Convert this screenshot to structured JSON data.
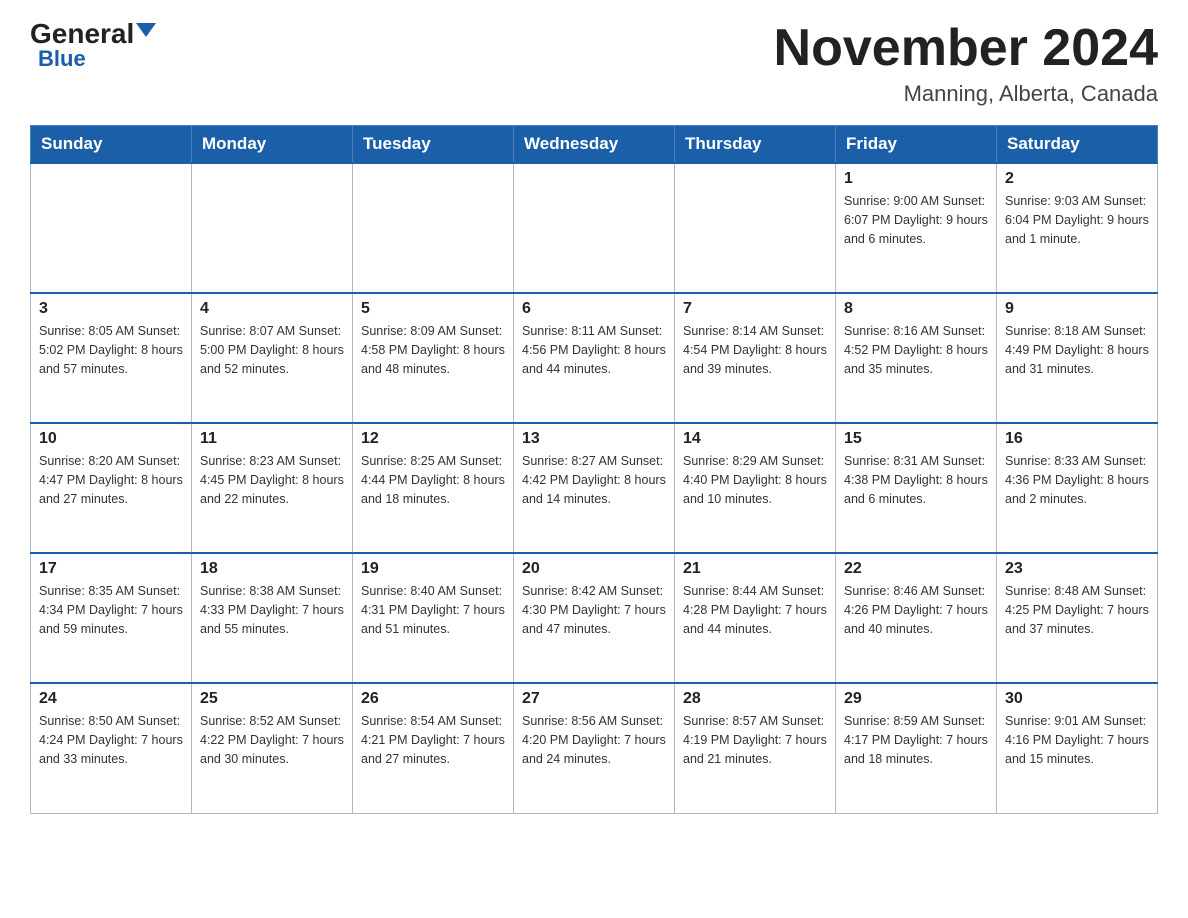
{
  "header": {
    "logo_general": "General",
    "logo_blue": "Blue",
    "month": "November 2024",
    "location": "Manning, Alberta, Canada"
  },
  "days_of_week": [
    "Sunday",
    "Monday",
    "Tuesday",
    "Wednesday",
    "Thursday",
    "Friday",
    "Saturday"
  ],
  "weeks": [
    [
      {
        "day": "",
        "info": ""
      },
      {
        "day": "",
        "info": ""
      },
      {
        "day": "",
        "info": ""
      },
      {
        "day": "",
        "info": ""
      },
      {
        "day": "",
        "info": ""
      },
      {
        "day": "1",
        "info": "Sunrise: 9:00 AM\nSunset: 6:07 PM\nDaylight: 9 hours\nand 6 minutes."
      },
      {
        "day": "2",
        "info": "Sunrise: 9:03 AM\nSunset: 6:04 PM\nDaylight: 9 hours\nand 1 minute."
      }
    ],
    [
      {
        "day": "3",
        "info": "Sunrise: 8:05 AM\nSunset: 5:02 PM\nDaylight: 8 hours\nand 57 minutes."
      },
      {
        "day": "4",
        "info": "Sunrise: 8:07 AM\nSunset: 5:00 PM\nDaylight: 8 hours\nand 52 minutes."
      },
      {
        "day": "5",
        "info": "Sunrise: 8:09 AM\nSunset: 4:58 PM\nDaylight: 8 hours\nand 48 minutes."
      },
      {
        "day": "6",
        "info": "Sunrise: 8:11 AM\nSunset: 4:56 PM\nDaylight: 8 hours\nand 44 minutes."
      },
      {
        "day": "7",
        "info": "Sunrise: 8:14 AM\nSunset: 4:54 PM\nDaylight: 8 hours\nand 39 minutes."
      },
      {
        "day": "8",
        "info": "Sunrise: 8:16 AM\nSunset: 4:52 PM\nDaylight: 8 hours\nand 35 minutes."
      },
      {
        "day": "9",
        "info": "Sunrise: 8:18 AM\nSunset: 4:49 PM\nDaylight: 8 hours\nand 31 minutes."
      }
    ],
    [
      {
        "day": "10",
        "info": "Sunrise: 8:20 AM\nSunset: 4:47 PM\nDaylight: 8 hours\nand 27 minutes."
      },
      {
        "day": "11",
        "info": "Sunrise: 8:23 AM\nSunset: 4:45 PM\nDaylight: 8 hours\nand 22 minutes."
      },
      {
        "day": "12",
        "info": "Sunrise: 8:25 AM\nSunset: 4:44 PM\nDaylight: 8 hours\nand 18 minutes."
      },
      {
        "day": "13",
        "info": "Sunrise: 8:27 AM\nSunset: 4:42 PM\nDaylight: 8 hours\nand 14 minutes."
      },
      {
        "day": "14",
        "info": "Sunrise: 8:29 AM\nSunset: 4:40 PM\nDaylight: 8 hours\nand 10 minutes."
      },
      {
        "day": "15",
        "info": "Sunrise: 8:31 AM\nSunset: 4:38 PM\nDaylight: 8 hours\nand 6 minutes."
      },
      {
        "day": "16",
        "info": "Sunrise: 8:33 AM\nSunset: 4:36 PM\nDaylight: 8 hours\nand 2 minutes."
      }
    ],
    [
      {
        "day": "17",
        "info": "Sunrise: 8:35 AM\nSunset: 4:34 PM\nDaylight: 7 hours\nand 59 minutes."
      },
      {
        "day": "18",
        "info": "Sunrise: 8:38 AM\nSunset: 4:33 PM\nDaylight: 7 hours\nand 55 minutes."
      },
      {
        "day": "19",
        "info": "Sunrise: 8:40 AM\nSunset: 4:31 PM\nDaylight: 7 hours\nand 51 minutes."
      },
      {
        "day": "20",
        "info": "Sunrise: 8:42 AM\nSunset: 4:30 PM\nDaylight: 7 hours\nand 47 minutes."
      },
      {
        "day": "21",
        "info": "Sunrise: 8:44 AM\nSunset: 4:28 PM\nDaylight: 7 hours\nand 44 minutes."
      },
      {
        "day": "22",
        "info": "Sunrise: 8:46 AM\nSunset: 4:26 PM\nDaylight: 7 hours\nand 40 minutes."
      },
      {
        "day": "23",
        "info": "Sunrise: 8:48 AM\nSunset: 4:25 PM\nDaylight: 7 hours\nand 37 minutes."
      }
    ],
    [
      {
        "day": "24",
        "info": "Sunrise: 8:50 AM\nSunset: 4:24 PM\nDaylight: 7 hours\nand 33 minutes."
      },
      {
        "day": "25",
        "info": "Sunrise: 8:52 AM\nSunset: 4:22 PM\nDaylight: 7 hours\nand 30 minutes."
      },
      {
        "day": "26",
        "info": "Sunrise: 8:54 AM\nSunset: 4:21 PM\nDaylight: 7 hours\nand 27 minutes."
      },
      {
        "day": "27",
        "info": "Sunrise: 8:56 AM\nSunset: 4:20 PM\nDaylight: 7 hours\nand 24 minutes."
      },
      {
        "day": "28",
        "info": "Sunrise: 8:57 AM\nSunset: 4:19 PM\nDaylight: 7 hours\nand 21 minutes."
      },
      {
        "day": "29",
        "info": "Sunrise: 8:59 AM\nSunset: 4:17 PM\nDaylight: 7 hours\nand 18 minutes."
      },
      {
        "day": "30",
        "info": "Sunrise: 9:01 AM\nSunset: 4:16 PM\nDaylight: 7 hours\nand 15 minutes."
      }
    ]
  ]
}
